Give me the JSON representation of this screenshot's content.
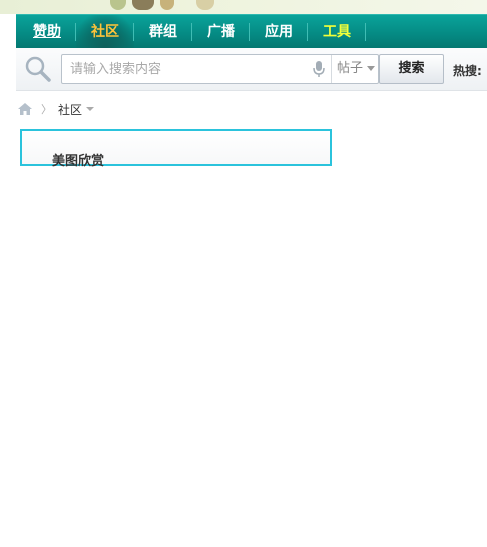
{
  "nav": {
    "items": [
      {
        "label": "赞助"
      },
      {
        "label": "社区"
      },
      {
        "label": "群组"
      },
      {
        "label": "广播"
      },
      {
        "label": "应用"
      },
      {
        "label": "工具"
      }
    ],
    "active_index": 1
  },
  "search": {
    "placeholder": "请输入搜索内容",
    "type_label": "帖子",
    "button_label": "搜索",
    "hot_label": "热搜:"
  },
  "breadcrumb": {
    "current": "社区"
  },
  "panel": {
    "title": "美图欣赏"
  },
  "colors": {
    "nav_bg": "#058b84",
    "nav_active_text": "#ffc43a",
    "nav_highlight_text": "#f2ff3a",
    "panel_border": "#2bc3dc"
  }
}
